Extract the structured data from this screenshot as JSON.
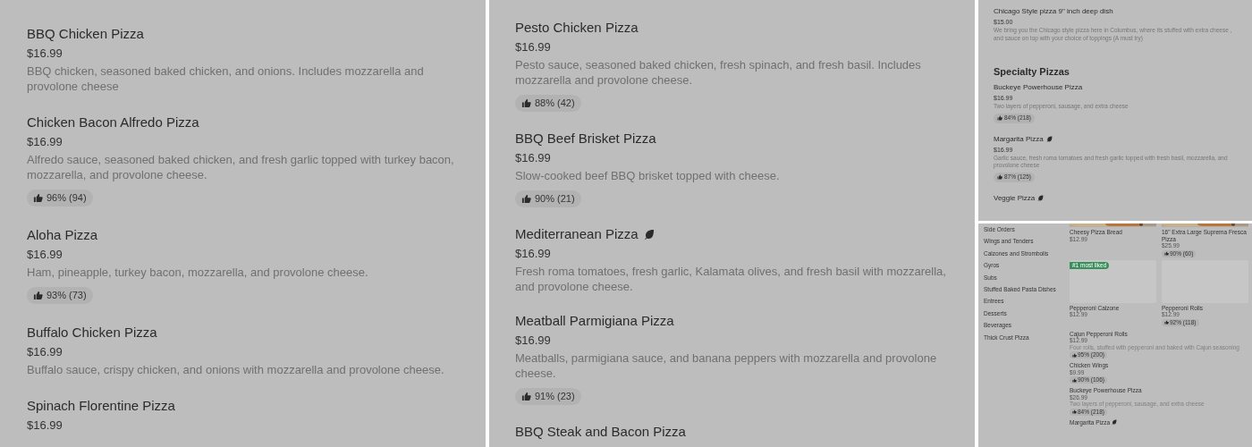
{
  "left_panel": {
    "items": [
      {
        "name": "BBQ Chicken Pizza",
        "price": "$16.99",
        "description": "BBQ chicken, seasoned baked chicken, and onions. Includes mozzarella and provolone cheese",
        "vegetarian": false
      },
      {
        "name": "Chicken Bacon Alfredo Pizza",
        "price": "$16.99",
        "description": "Alfredo sauce, seasoned baked chicken, and fresh garlic topped with turkey bacon, mozzarella, and provolone cheese.",
        "rating": "96% (94)",
        "vegetarian": false
      },
      {
        "name": "Aloha Pizza",
        "price": "$16.99",
        "description": "Ham, pineapple, turkey bacon, mozzarella, and provolone cheese.",
        "rating": "93% (73)",
        "vegetarian": false
      },
      {
        "name": "Buffalo Chicken Pizza",
        "price": "$16.99",
        "description": "Buffalo sauce, crispy chicken, and onions with mozzarella and provolone cheese.",
        "vegetarian": false
      },
      {
        "name": "Spinach Florentine Pizza",
        "price": "$16.99",
        "vegetarian": false
      }
    ]
  },
  "middle_panel": {
    "items": [
      {
        "name": "Pesto Chicken Pizza",
        "price": "$16.99",
        "description": "Pesto sauce, seasoned baked chicken, fresh spinach, and fresh basil. Includes mozzarella and provolone cheese.",
        "rating": "88% (42)",
        "vegetarian": false
      },
      {
        "name": "BBQ Beef Brisket Pizza",
        "price": "$16.99",
        "description": "Slow-cooked beef BBQ brisket topped with cheese.",
        "rating": "90% (21)",
        "vegetarian": false
      },
      {
        "name": "Mediterranean Pizza",
        "price": "$16.99",
        "description": "Fresh roma tomatoes, fresh garlic, Kalamata olives, and fresh basil with mozzarella, and provolone cheese.",
        "vegetarian": true
      },
      {
        "name": "Meatball Parmigiana Pizza",
        "price": "$16.99",
        "description": "Meatballs, parmigiana sauce, and banana peppers with mozzarella and provolone cheese.",
        "rating": "91% (23)",
        "vegetarian": false
      },
      {
        "name": "BBQ Steak and Bacon Pizza",
        "vegetarian": false
      }
    ]
  },
  "top_right_panel": {
    "items_before": [
      {
        "name": "Chicago Style pizza 9\" inch deep dish",
        "price": "$15.00",
        "description": "We bring you the Chicago style pizza here in Columbus, where its stuffed with extra cheese , and sauce on top with your choice of toppings (A must try)",
        "vegetarian": false
      }
    ],
    "section_title": "Specialty Pizzas",
    "items": [
      {
        "name": "Buckeye Powerhouse Pizza",
        "price": "$16.99",
        "description": "Two layers of pepperoni, sausage, and extra cheese",
        "rating": "84% (218)",
        "vegetarian": false
      },
      {
        "name": "Margarita Pizza",
        "price": "$16.99",
        "description": "Garlic sauce, fresh roma tomatoes and fresh garlic topped with fresh basil, mozzarella, and provolone cheese",
        "rating": "87% (125)",
        "vegetarian": true
      },
      {
        "name": "Veggie Pizza",
        "vegetarian": true
      }
    ]
  },
  "bottom_right_panel": {
    "categories": [
      "Side Orders",
      "Wings and Tenders",
      "Calzones and Strombolis",
      "Gyros",
      "Subs",
      "Stuffed Baked Pasta Dishes",
      "Entrees",
      "Desserts",
      "Beverages",
      "Thick Crust Pizza"
    ],
    "tiles": [
      {
        "kind": "picture",
        "name": "Cheesy Pizza Bread",
        "price": "$12.99"
      },
      {
        "kind": "picture",
        "name": "16\" Extra Large Suprema Fresca Pizza",
        "price": "$25.99",
        "rating": "90% (60)"
      },
      {
        "kind": "placeholder",
        "badge": "#1 most liked",
        "name": "Pepperoni Calzone",
        "price": "$12.99"
      },
      {
        "kind": "placeholder",
        "name": "Pepperoni Rolls",
        "price": "$12.99",
        "rating": "92% (118)"
      }
    ],
    "items": [
      {
        "name": "Cajun Pepperoni Rolls",
        "price": "$12.99",
        "description": "Four rolls, stuffed with pepperoni and baked with Cajun seasoning",
        "rating": "95% (200)",
        "vegetarian": false
      },
      {
        "name": "Chicken Wings",
        "price": "$9.99",
        "rating": "90% (106)",
        "vegetarian": false
      },
      {
        "name": "Buckeye Powerhouse Pizza",
        "price": "$26.99",
        "description": "Two layers of pepperoni, sausage, and extra cheese",
        "rating": "84% (218)",
        "vegetarian": false
      },
      {
        "name": "Margarita Pizza",
        "vegetarian": true
      }
    ]
  }
}
